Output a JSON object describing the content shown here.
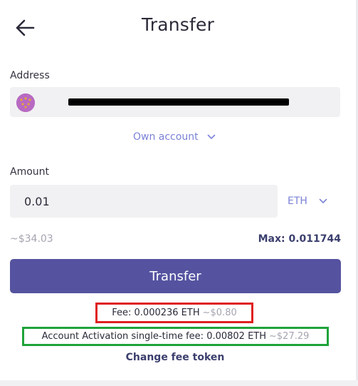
{
  "header": {
    "title": "Transfer",
    "back_icon": "arrow-left-icon"
  },
  "address": {
    "label": "Address",
    "avatar_icon": "identicon-avatar",
    "value_redacted": true
  },
  "own_account": {
    "label": "Own account",
    "icon": "chevron-down-icon"
  },
  "amount": {
    "label": "Amount",
    "value": "0.01",
    "token": "ETH",
    "usd_value": "~$34.03",
    "max": "Max: 0.011744"
  },
  "actions": {
    "transfer_label": "Transfer",
    "change_fee_token": "Change fee token"
  },
  "fees": {
    "fee_text": "Fee: 0.000236 ETH",
    "fee_usd": "~$0.80",
    "activation_text": "Account Activation single-time fee: 0.00802 ETH",
    "activation_usd": "~$27.29"
  },
  "colors": {
    "accent": "#5553a0",
    "link": "#7b82d6",
    "fee_highlight": "#e02020",
    "activation_highlight": "#1fa33a"
  }
}
